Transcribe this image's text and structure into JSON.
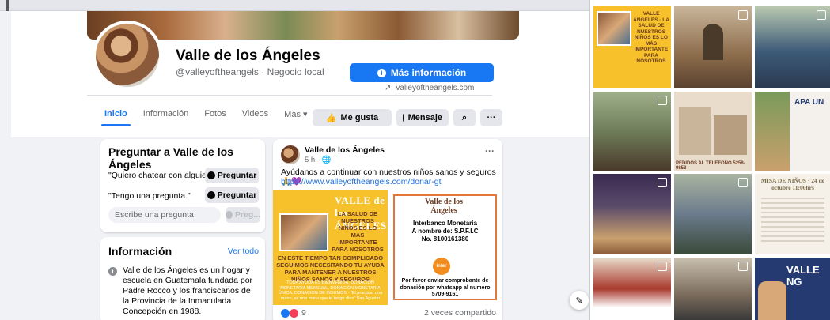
{
  "page": {
    "name": "Valle de los Ángeles",
    "handle": "@valleyoftheangels · Negocio local",
    "more_info_label": "Más información",
    "website": "valleyoftheangels.com"
  },
  "tabs": [
    {
      "label": "Inicio"
    },
    {
      "label": "Información"
    },
    {
      "label": "Fotos"
    },
    {
      "label": "Videos"
    },
    {
      "label": "Más ▾"
    }
  ],
  "actions": {
    "like": "Me gusta",
    "message": "Mensaje",
    "search_glyph": "⌕",
    "more_glyph": "···"
  },
  "ask": {
    "title": "Preguntar a Valle de los Ángeles",
    "q1": "\"Quiero chatear con alguien.\"",
    "q2": "\"Tengo una pregunta.\"",
    "button": "Preguntar",
    "input_placeholder": "Escribe una pregunta",
    "disabled_button": "Preg..."
  },
  "info": {
    "title": "Información",
    "see_all": "Ver todo",
    "text": "Valle de los Ángeles es un hogar y escuela en Guatemala fundada por Padre Rocco y los franciscanos de la Provincia de la Inmaculada Concepción en 1988."
  },
  "post": {
    "author": "Valle de los Ángeles",
    "time": "5 h · 🌐",
    "text": "Ayúdanos a continuar con nuestros niños sanos y seguros 🙏💜",
    "link": "https://www.valleyoftheangels.com/donar-gt",
    "left_image": {
      "logo": "VALLE de los ÁNGELES",
      "headline": "LA SALUD DE NUESTROS NIÑOS ES LO MÁS IMPORTANTE PARA NOSOTROS",
      "body": "EN ESTE TIEMPO TAN COMPLICADO SEGUIMOS NECESITANDO TU AYUDA PARA MANTENER A NUESTROS NIÑOS SANOS Y SEGUROS",
      "small": "TODA AYUDA ES BIENVENIDA, DONACIÓN MONETARIA MENSUAL, DONACIÓN MONETARIA ÚNICA, DONACIÓN DE INSUMOS · \"El practicar una mano, es una mano que te tengo dios\" San Agustín"
    },
    "right_image": {
      "logo": "Valle de los Ángeles",
      "bank": "Interbanco Monetaria",
      "account_name": "A nombre de: S.P.F.I.C",
      "account_no": "No. 8100161380",
      "coin": "inter",
      "footer": "Por favor enviar comprobante de donación por whatsapp al numero 5709-9161"
    },
    "reactions_count": "9",
    "shares": "2 veces compartido"
  },
  "grid_tiles": [
    {
      "label": "VALLE ÁNGELES · LA SALUD DE NUESTROS NIÑOS ES LO MÁS IMPORTANTE PARA NOSOTROS",
      "color": "#f6c12a"
    },
    {
      "label": "",
      "color": "#8b6b4a"
    },
    {
      "label": "",
      "color": "#3d5a78"
    },
    {
      "label": "",
      "color": "#6f7d5a"
    },
    {
      "label": "PEDIDOS AL TELEFONO 5258-9853",
      "color": "#e9dccb"
    },
    {
      "label": "APA UN",
      "color": "#f4f1ec"
    },
    {
      "label": "",
      "color": "#5a4a6a"
    },
    {
      "label": "MISA DE NIÑOS · 24 de octubre 11:00hrs",
      "color": "#f5f1e8"
    },
    {
      "label": "",
      "color": "#6b7b8c"
    },
    {
      "label": "",
      "color": "#a83a2e"
    },
    {
      "label": "",
      "color": "#7a6b5a"
    },
    {
      "label": "VALLE NG",
      "color": "#243a70"
    }
  ]
}
